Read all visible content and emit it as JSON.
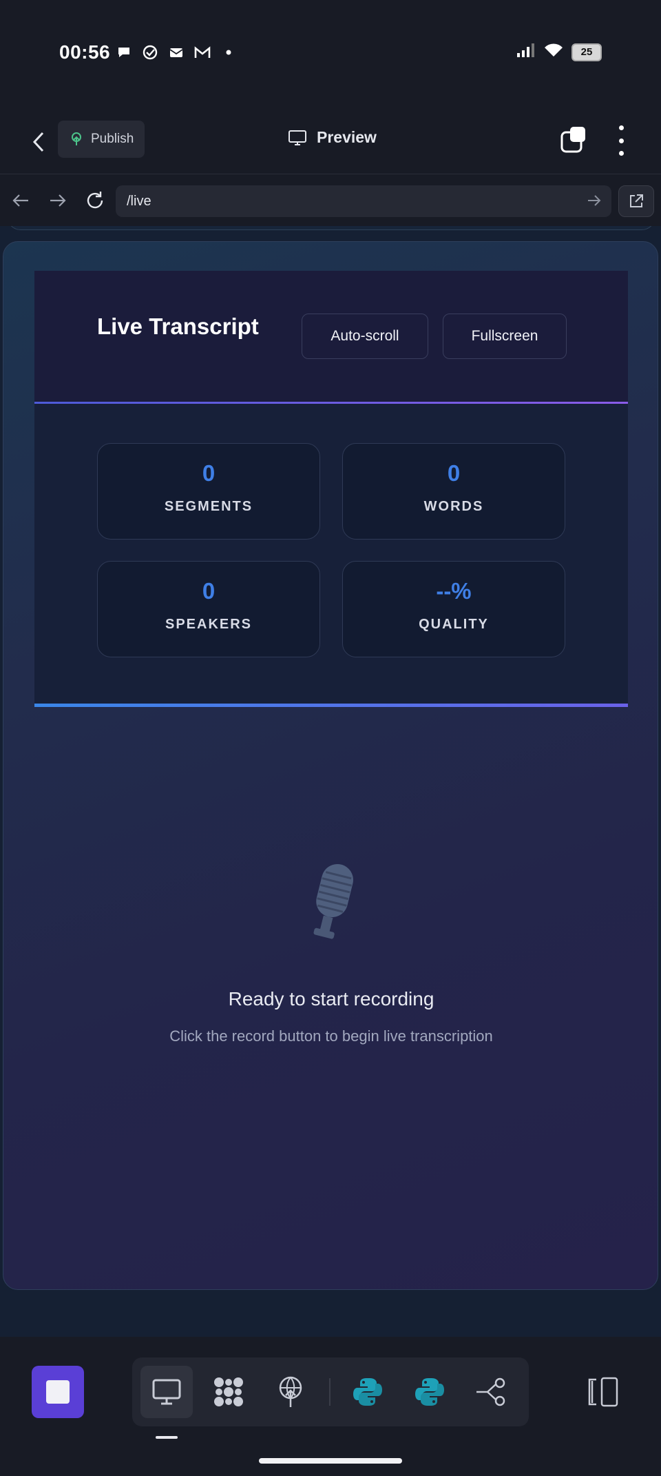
{
  "status_bar": {
    "time": "00:56",
    "battery": "25",
    "notification_icons": [
      "chat-bubble-icon",
      "check-circle-icon",
      "mail-icon",
      "gmail-icon",
      "dot-icon"
    ],
    "system_icons": [
      "signal-icon",
      "wifi-icon",
      "battery-icon"
    ]
  },
  "app_bar": {
    "publish_label": "Publish",
    "preview_label": "Preview"
  },
  "browser": {
    "url": "/live"
  },
  "transcript": {
    "title": "Live Transcript",
    "autoscroll_label": "Auto-scroll",
    "fullscreen_label": "Fullscreen",
    "stats": [
      {
        "value": "0",
        "label": "SEGMENTS"
      },
      {
        "value": "0",
        "label": "WORDS"
      },
      {
        "value": "0",
        "label": "SPEAKERS"
      },
      {
        "value": "--%",
        "label": "QUALITY"
      }
    ],
    "empty_title": "Ready to start recording",
    "empty_hint": "Click the record button to begin live transcription"
  },
  "toolbar": {
    "tools": [
      "desktop-icon",
      "grid-icon",
      "deploy-icon",
      "python-icon",
      "python-icon",
      "share-icon"
    ],
    "active_tool": "desktop-icon"
  },
  "colors": {
    "accent_blue": "#3f7fe6",
    "stop_purple": "#5a3fd6",
    "python_teal": "#1ea1b8"
  }
}
